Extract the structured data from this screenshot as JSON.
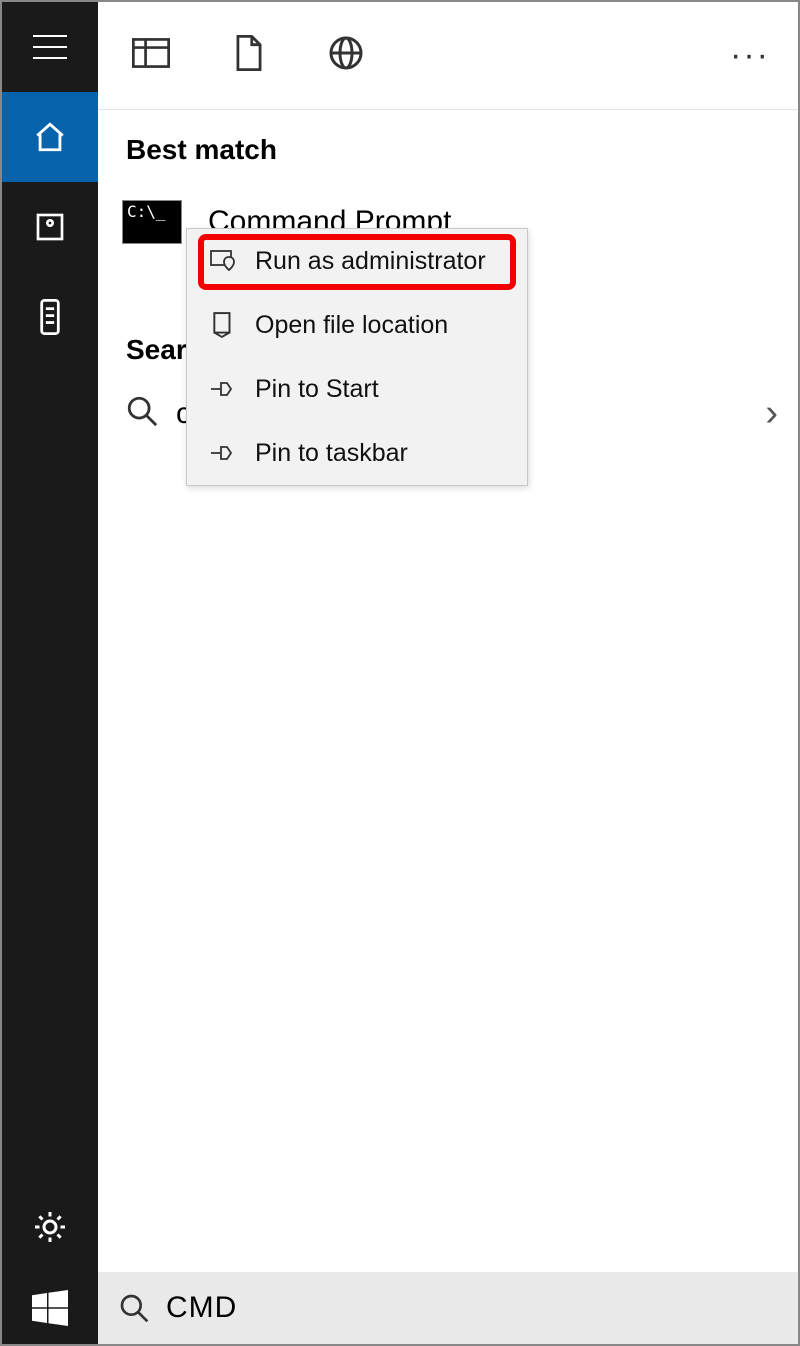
{
  "sidebar": {
    "items": [
      "menu",
      "home",
      "folder",
      "remote",
      "settings",
      "feedback"
    ]
  },
  "top_tabs": [
    "recent",
    "document",
    "web"
  ],
  "section_best_match": "Best match",
  "result": {
    "title": "Command Prompt",
    "icon_text": "C:\\_"
  },
  "search_suggestions_label": "Search suggestions",
  "suggestion_partial": "c",
  "context_menu": {
    "items": [
      {
        "icon": "admin",
        "label": "Run as administrator"
      },
      {
        "icon": "location",
        "label": "Open file location"
      },
      {
        "icon": "pin",
        "label": "Pin to Start"
      },
      {
        "icon": "pin",
        "label": "Pin to taskbar"
      }
    ]
  },
  "search_query": "CMD",
  "highlight_index": 0
}
